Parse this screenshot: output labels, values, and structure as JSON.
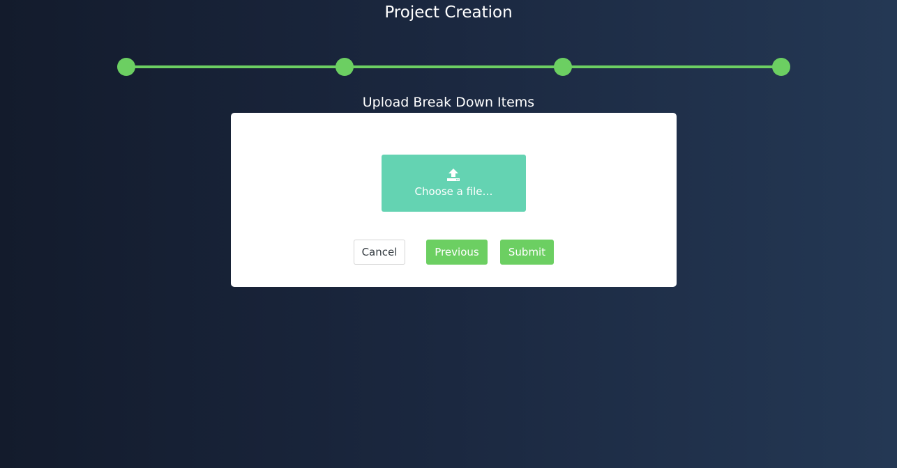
{
  "page": {
    "title": "Project Creation"
  },
  "stepper": {
    "total_steps": 4,
    "completed_steps": 4,
    "accent_color": "#6ccf62"
  },
  "step": {
    "title": "Upload Break Down Items"
  },
  "upload": {
    "icon": "upload-icon",
    "label": "Choose a file…",
    "background_color": "#64d3b2"
  },
  "actions": {
    "cancel_label": "Cancel",
    "previous_label": "Previous",
    "submit_label": "Submit"
  },
  "colors": {
    "background_start": "#131b2c",
    "background_end": "#243854",
    "card": "#ffffff"
  }
}
